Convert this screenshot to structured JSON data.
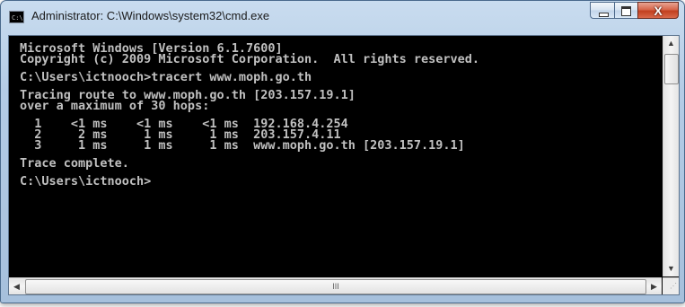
{
  "window": {
    "title": "Administrator: C:\\Windows\\system32\\cmd.exe",
    "icon_label": "C:\\",
    "buttons": {
      "minimize": "minimize-icon",
      "maximize": "maximize-icon",
      "close_glyph": "X"
    }
  },
  "console": {
    "lines": [
      "Microsoft Windows [Version 6.1.7600]",
      "Copyright (c) 2009 Microsoft Corporation.  All rights reserved.",
      "",
      "C:\\Users\\ictnooch>tracert www.moph.go.th",
      "",
      "Tracing route to www.moph.go.th [203.157.19.1]",
      "over a maximum of 30 hops:",
      "",
      "  1    <1 ms    <1 ms    <1 ms  192.168.4.254",
      "  2     2 ms     1 ms     1 ms  203.157.4.11",
      "  3     1 ms     1 ms     1 ms  www.moph.go.th [203.157.19.1]",
      "",
      "Trace complete.",
      "",
      "C:\\Users\\ictnooch>"
    ]
  },
  "scrollbars": {
    "up_arrow": "▲",
    "down_arrow": "▼",
    "left_arrow": "◀",
    "right_arrow": "▶",
    "grip": "III",
    "size_grip": "⋰"
  },
  "colors": {
    "console_bg": "#000000",
    "console_text": "#c0c0c0",
    "close_button": "#c2401f"
  }
}
